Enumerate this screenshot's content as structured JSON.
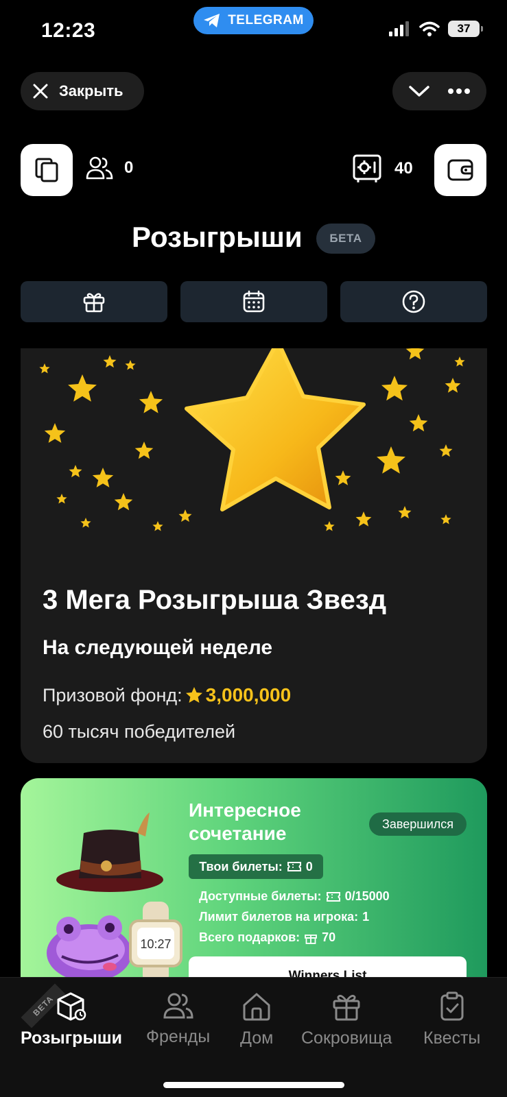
{
  "status_bar": {
    "time": "12:23",
    "app_pill": "TELEGRAM",
    "battery": "37"
  },
  "header": {
    "close_label": "Закрыть"
  },
  "stats": {
    "friends_count": "0",
    "safe_count": "40"
  },
  "page": {
    "title": "Розыгрыши",
    "beta": "БЕТА"
  },
  "tabs": [
    {
      "icon": "gift-icon"
    },
    {
      "icon": "calendar-icon"
    },
    {
      "icon": "help-icon"
    }
  ],
  "mega_card": {
    "title": "3 Мега Розыгрыша Звезд",
    "subtitle": "На следующей неделе",
    "prize_label": "Призовой фонд:",
    "prize_value": "3,000,000",
    "winners": "60 тысяч победителей"
  },
  "giveaway_card": {
    "title": "Интересное сочетание",
    "status": "Завершился",
    "your_tickets_label": "Твои билеты:",
    "your_tickets_value": "0",
    "available_label": "Доступные билеты:",
    "available_value": "0/15000",
    "limit_label": "Лимит билетов на игрока:",
    "limit_value": "1",
    "gifts_label": "Всего подарков:",
    "gifts_value": "70",
    "button_label": "Winners List"
  },
  "bottom_nav": {
    "beta_ribbon": "BETA",
    "items": [
      {
        "label": "Розыгрыши",
        "icon": "cube-icon",
        "active": true
      },
      {
        "label": "Френды",
        "icon": "friends-icon",
        "active": false
      },
      {
        "label": "Дом",
        "icon": "home-icon",
        "active": false
      },
      {
        "label": "Сокровища",
        "icon": "gift-icon",
        "active": false
      },
      {
        "label": "Квесты",
        "icon": "clipboard-icon",
        "active": false
      }
    ]
  },
  "colors": {
    "accent_gold": "#f6c21b",
    "telegram_blue": "#2f8df0",
    "tab_bg": "#1d2630"
  }
}
